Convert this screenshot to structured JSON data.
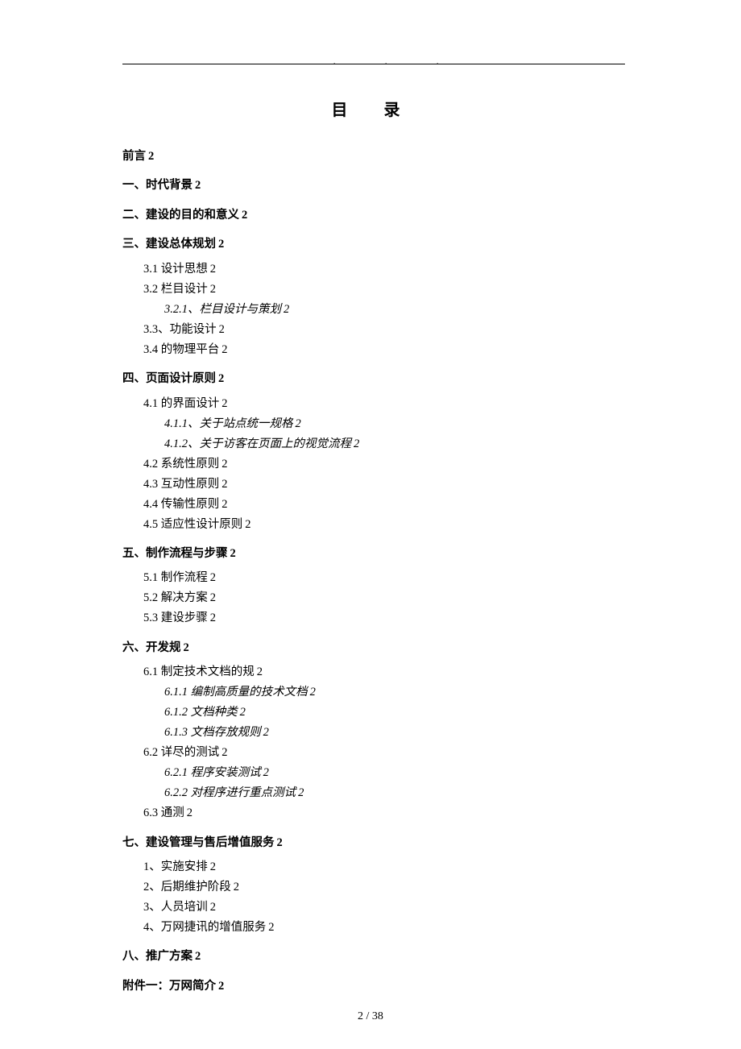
{
  "title": "目 录",
  "header_dots": "...",
  "toc": [
    {
      "level": 1,
      "text": "前言",
      "page": "2"
    },
    {
      "level": 1,
      "text": "一、时代背景",
      "page": "2"
    },
    {
      "level": 1,
      "text": "二、建设的目的和意义",
      "page": "2"
    },
    {
      "level": 1,
      "text": "三、建设总体规划",
      "page": "2"
    },
    {
      "level": 2,
      "text": "3.1 设计思想",
      "page": "2"
    },
    {
      "level": 2,
      "text": "3.2 栏目设计",
      "page": "2"
    },
    {
      "level": 3,
      "text": "3.2.1、栏目设计与策划",
      "page": "2"
    },
    {
      "level": 2,
      "text": "3.3、功能设计",
      "page": "2"
    },
    {
      "level": 2,
      "text": "3.4 的物理平台",
      "page": "2"
    },
    {
      "level": 1,
      "text": "四、页面设计原则",
      "page": "2"
    },
    {
      "level": 2,
      "text": "4.1 的界面设计",
      "page": "2"
    },
    {
      "level": 3,
      "text": "4.1.1、关于站点统一规格",
      "page": "2"
    },
    {
      "level": 3,
      "text": "4.1.2、关于访客在页面上的视觉流程",
      "page": "2"
    },
    {
      "level": 2,
      "text": "4.2 系统性原则",
      "page": "2"
    },
    {
      "level": 2,
      "text": "4.3 互动性原则",
      "page": "2"
    },
    {
      "level": 2,
      "text": "4.4 传输性原则",
      "page": "2"
    },
    {
      "level": 2,
      "text": "4.5 适应性设计原则",
      "page": "2"
    },
    {
      "level": 1,
      "text": "五、制作流程与步骤",
      "page": "2"
    },
    {
      "level": 2,
      "text": "5.1 制作流程",
      "page": "2"
    },
    {
      "level": 2,
      "text": "5.2 解决方案",
      "page": "2"
    },
    {
      "level": 2,
      "text": "5.3 建设步骤",
      "page": "2"
    },
    {
      "level": 1,
      "text": "六、开发规",
      "page": "2"
    },
    {
      "level": 2,
      "text": "6.1 制定技术文档的规",
      "page": "2"
    },
    {
      "level": 3,
      "text": "6.1.1 编制高质量的技术文档",
      "page": "2"
    },
    {
      "level": 3,
      "text": "6.1.2 文档种类",
      "page": "2"
    },
    {
      "level": 3,
      "text": "6.1.3 文档存放规则",
      "page": "2"
    },
    {
      "level": 2,
      "text": "6.2 详尽的测试",
      "page": "2"
    },
    {
      "level": 3,
      "text": "6.2.1 程序安装测试",
      "page": "2"
    },
    {
      "level": 3,
      "text": "6.2.2 对程序进行重点测试",
      "page": "2"
    },
    {
      "level": 2,
      "text": "6.3 通测",
      "page": "2"
    },
    {
      "level": 1,
      "text": "七、建设管理与售后增值服务",
      "page": "2"
    },
    {
      "level": 2,
      "text": "1、实施安排",
      "page": "2"
    },
    {
      "level": 2,
      "text": "2、后期维护阶段",
      "page": "2"
    },
    {
      "level": 2,
      "text": "3、人员培训",
      "page": "2"
    },
    {
      "level": 2,
      "text": "4、万网捷讯的增值服务",
      "page": "2"
    },
    {
      "level": 1,
      "text": "八、推广方案",
      "page": "2"
    },
    {
      "level": 1,
      "text": "附件一：万网简介",
      "page": "2"
    }
  ],
  "footer": "2  / 38"
}
